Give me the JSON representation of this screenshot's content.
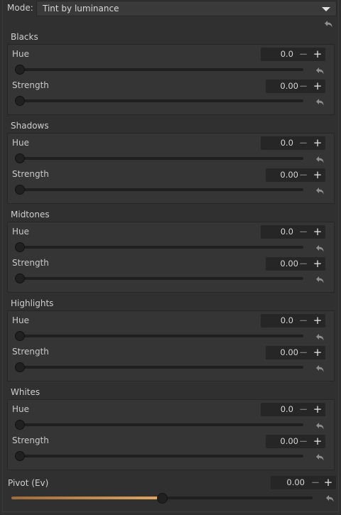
{
  "mode": {
    "label": "Mode:",
    "value": "Tint by luminance"
  },
  "field_labels": {
    "hue": "Hue",
    "strength": "Strength"
  },
  "sections": [
    {
      "title": "Blacks",
      "hue": "0.0",
      "strength": "0.00"
    },
    {
      "title": "Shadows",
      "hue": "0.0",
      "strength": "0.00"
    },
    {
      "title": "Midtones",
      "hue": "0.0",
      "strength": "0.00"
    },
    {
      "title": "Highlights",
      "hue": "0.0",
      "strength": "0.00"
    },
    {
      "title": "Whites",
      "hue": "0.0",
      "strength": "0.00"
    }
  ],
  "pivot": {
    "label": "Pivot (Ev)",
    "value": "0.00",
    "slider_fraction": 0.5
  },
  "buttons": {
    "minus": "−",
    "plus": "+"
  },
  "icons": {
    "dropdown": "chevron-down-icon",
    "reset": "undo-arrow-icon"
  },
  "colors": {
    "pivot_gradient_start": "#a06a3a",
    "pivot_gradient_end": "#e0a860"
  }
}
